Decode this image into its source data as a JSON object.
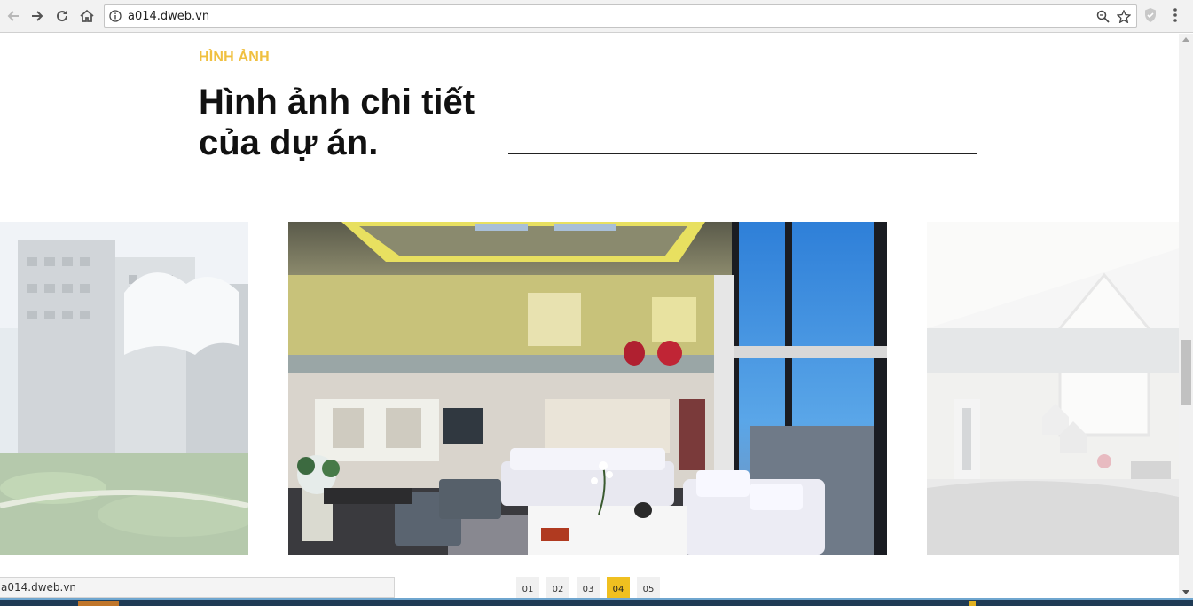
{
  "browser": {
    "url": "a014.dweb.vn",
    "status_url": "a014.dweb.vn"
  },
  "section": {
    "eyebrow": "HÌNH ẢNH",
    "title": "Hình ảnh chi tiết của dự án."
  },
  "gallery": {
    "slides": [
      {
        "name": "building-exterior"
      },
      {
        "name": "penthouse-living-room"
      },
      {
        "name": "kids-bedroom"
      }
    ],
    "pager": [
      "01",
      "02",
      "03",
      "04",
      "05"
    ],
    "active_page": "04"
  },
  "colors": {
    "accent": "#f0c020",
    "eyebrow": "#f0c040",
    "heading": "#111111"
  }
}
